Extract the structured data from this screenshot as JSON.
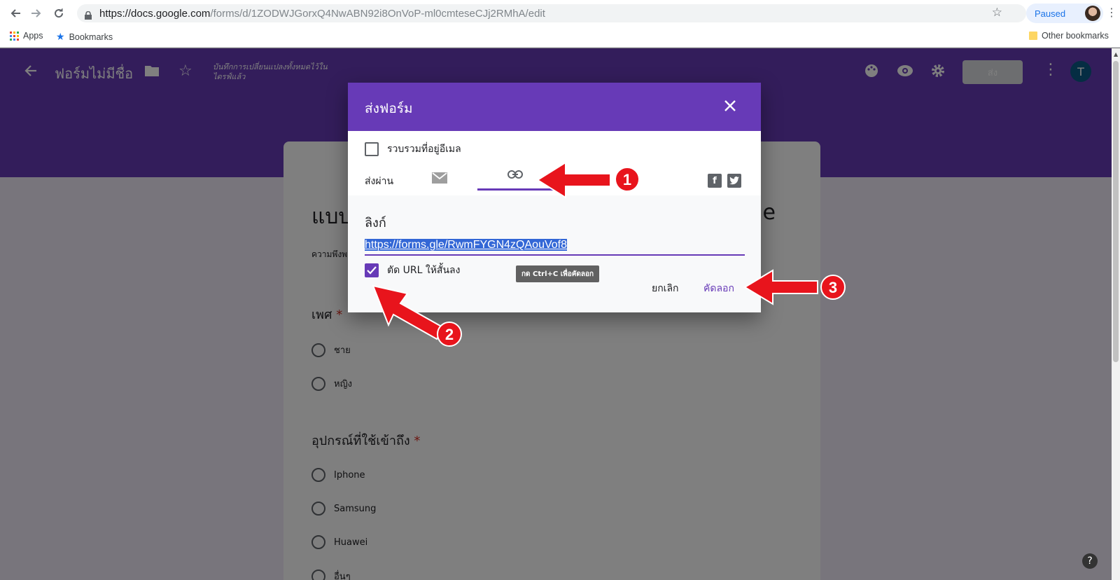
{
  "browser": {
    "url_host": "https://docs.google.com",
    "url_path": "/forms/d/1ZODWJGorxQ4NwABN92i8OnVoP-ml0cmteseCJj2RMhA/edit",
    "profile_status": "Paused",
    "bookmarks": {
      "apps_label": "Apps",
      "bookmarks_label": "Bookmarks",
      "other_label": "Other bookmarks"
    }
  },
  "forms_header": {
    "title": "ฟอร์มไม่มีชื่อ",
    "saved_status": "บันทึกการเปลี่ยนแปลงทั้งหมดไว้ในไดรฟ์แล้ว",
    "send_label": "ส่ง",
    "avatar_letter": "T",
    "icons": [
      "back-arrow-icon",
      "folder-icon",
      "star-icon",
      "palette-icon",
      "eye-icon",
      "gear-icon",
      "more-vert-icon"
    ]
  },
  "form": {
    "title_start": "แบบ",
    "title_end": "de",
    "description": "ความพึงพ",
    "questions": [
      {
        "title": "เพศ",
        "required": "*",
        "options": [
          "ชาย",
          "หญิง"
        ]
      },
      {
        "title": "อุปกรณ์ที่ใช้เข้าถึง",
        "required": "*",
        "options": [
          "Iphone",
          "Samsung",
          "Huawei",
          "อื่นๆ"
        ]
      }
    ]
  },
  "dialog": {
    "title": "ส่งฟอร์ม",
    "collect_email_label": "รวบรวมที่อยู่อีเมล",
    "send_via_label": "ส่งผ่าน",
    "link_section_title": "ลิงก์",
    "link_url": "https://forms.gle/RwmFYGN4zQAouVof8",
    "shorten_label": "ตัด URL ให้สั้นลง",
    "tooltip": "กด Ctrl+C เพื่อคัดลอก",
    "cancel_label": "ยกเลิก",
    "copy_label": "คัดลอก",
    "social_icons": [
      "facebook-icon",
      "twitter-icon"
    ]
  },
  "annotations": {
    "step1": "1",
    "step2": "2",
    "step3": "3",
    "color": "#e8141c"
  },
  "colors": {
    "forms_purple": "#673ab7",
    "overlay": "rgba(0,0,0,0.5)"
  }
}
